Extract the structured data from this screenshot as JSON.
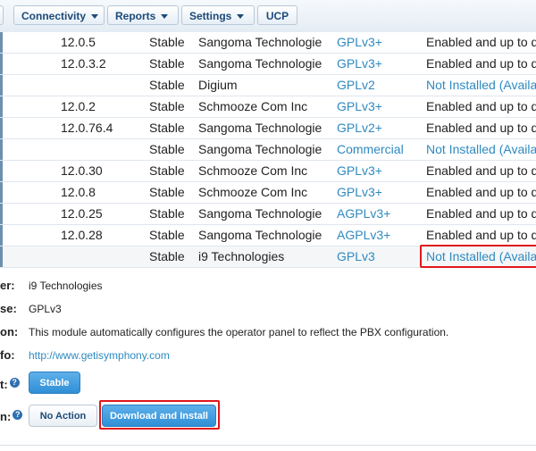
{
  "nav": {
    "connectivity": "Connectivity",
    "reports": "Reports",
    "settings": "Settings",
    "ucp": "UCP"
  },
  "modules": [
    {
      "version": "12.0.5",
      "track": "Stable",
      "publisher": "Sangoma Technologie",
      "license": "GPLv3+",
      "status": "Enabled and up to d",
      "status_link": false
    },
    {
      "version": "12.0.3.2",
      "track": "Stable",
      "publisher": "Sangoma Technologie",
      "license": "GPLv3+",
      "status": "Enabled and up to d",
      "status_link": false
    },
    {
      "version": "",
      "track": "Stable",
      "publisher": "Digium",
      "license": "GPLv2",
      "status": "Not Installed (Availa",
      "status_link": true
    },
    {
      "version": "12.0.2",
      "track": "Stable",
      "publisher": "Schmooze Com Inc",
      "license": "GPLv3+",
      "status": "Enabled and up to d",
      "status_link": false
    },
    {
      "version": "12.0.76.4",
      "track": "Stable",
      "publisher": "Sangoma Technologie",
      "license": "GPLv2+",
      "status": "Enabled and up to d",
      "status_link": false
    },
    {
      "version": "",
      "track": "Stable",
      "publisher": "Sangoma Technologie",
      "license": "Commercial",
      "status": "Not Installed (Availa",
      "status_link": true
    },
    {
      "version": "12.0.30",
      "track": "Stable",
      "publisher": "Schmooze Com Inc",
      "license": "GPLv3+",
      "status": "Enabled and up to d",
      "status_link": false
    },
    {
      "version": "12.0.8",
      "track": "Stable",
      "publisher": "Schmooze Com Inc",
      "license": "GPLv3+",
      "status": "Enabled and up to d",
      "status_link": false
    },
    {
      "version": "12.0.25",
      "track": "Stable",
      "publisher": "Sangoma Technologie",
      "license": "AGPLv3+",
      "status": "Enabled and up to d",
      "status_link": false
    },
    {
      "version": "12.0.28",
      "track": "Stable",
      "publisher": "Sangoma Technologie",
      "license": "AGPLv3+",
      "status": "Enabled and up to d",
      "status_link": false
    },
    {
      "version": "",
      "track": "Stable",
      "publisher": "i9 Technologies",
      "license": "GPLv3",
      "status": "Not Installed (Availa",
      "status_link": true
    }
  ],
  "detail": {
    "publisher_label": "er:",
    "publisher": "i9 Technologies",
    "license_label": "se:",
    "license": "GPLv3",
    "description_label": "on:",
    "description": "This module automatically configures the operator panel to reflect the PBX configuration.",
    "info_label": "fo:",
    "info_url": "http://www.getisymphony.com",
    "track_label": "t:",
    "track_button": "Stable",
    "action_label": "n:",
    "no_action_button": "No Action",
    "download_button": "Download and Install"
  },
  "colors": {
    "link": "#2e8ac0",
    "highlight_border": "#e0161b",
    "primary_button": "#2f8fd6"
  }
}
